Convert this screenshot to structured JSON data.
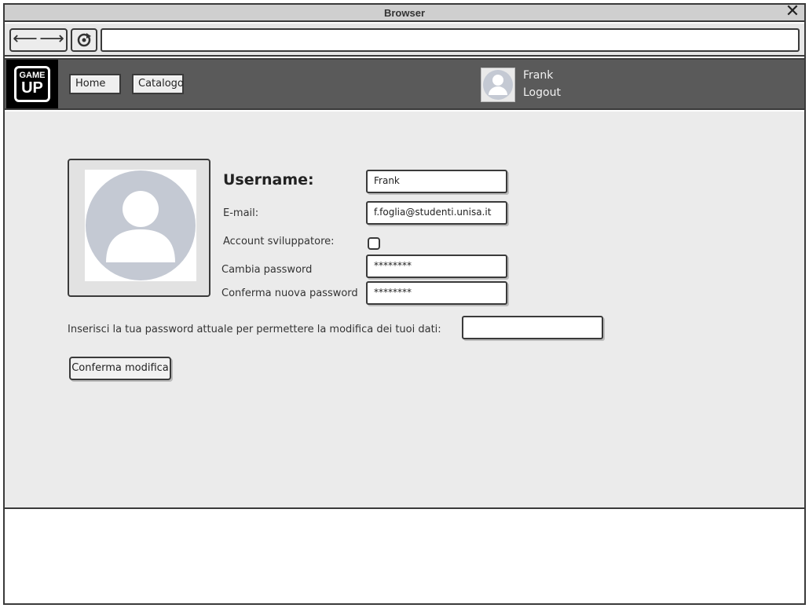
{
  "browser": {
    "title": "Browser",
    "close_glyph": "✕",
    "back_glyph": "⟵",
    "forward_glyph": "⟶",
    "url": ""
  },
  "header": {
    "logo_line1": "GAME",
    "logo_line2": "UP",
    "nav": [
      {
        "label": "Home"
      },
      {
        "label": "Catalogo"
      }
    ],
    "user": {
      "name": "Frank",
      "logout_label": "Logout"
    }
  },
  "profile": {
    "username_label": "Username:",
    "username_value": "Frank",
    "email_label": "E-mail:",
    "email_value": "f.foglia@studenti.unisa.it",
    "developer_label": "Account sviluppatore:",
    "developer_checked": false,
    "change_password_label": "Cambia password",
    "change_password_value": "********",
    "confirm_password_label": "Conferma nuova password",
    "confirm_password_value": "********",
    "current_password_prompt": "Inserisci la tua password attuale per permettere la modifica dei tuoi dati:",
    "current_password_value": "",
    "submit_label": "Conferma modifica"
  },
  "icons": {
    "avatar": "user-avatar-icon",
    "reload": "reload-icon"
  }
}
